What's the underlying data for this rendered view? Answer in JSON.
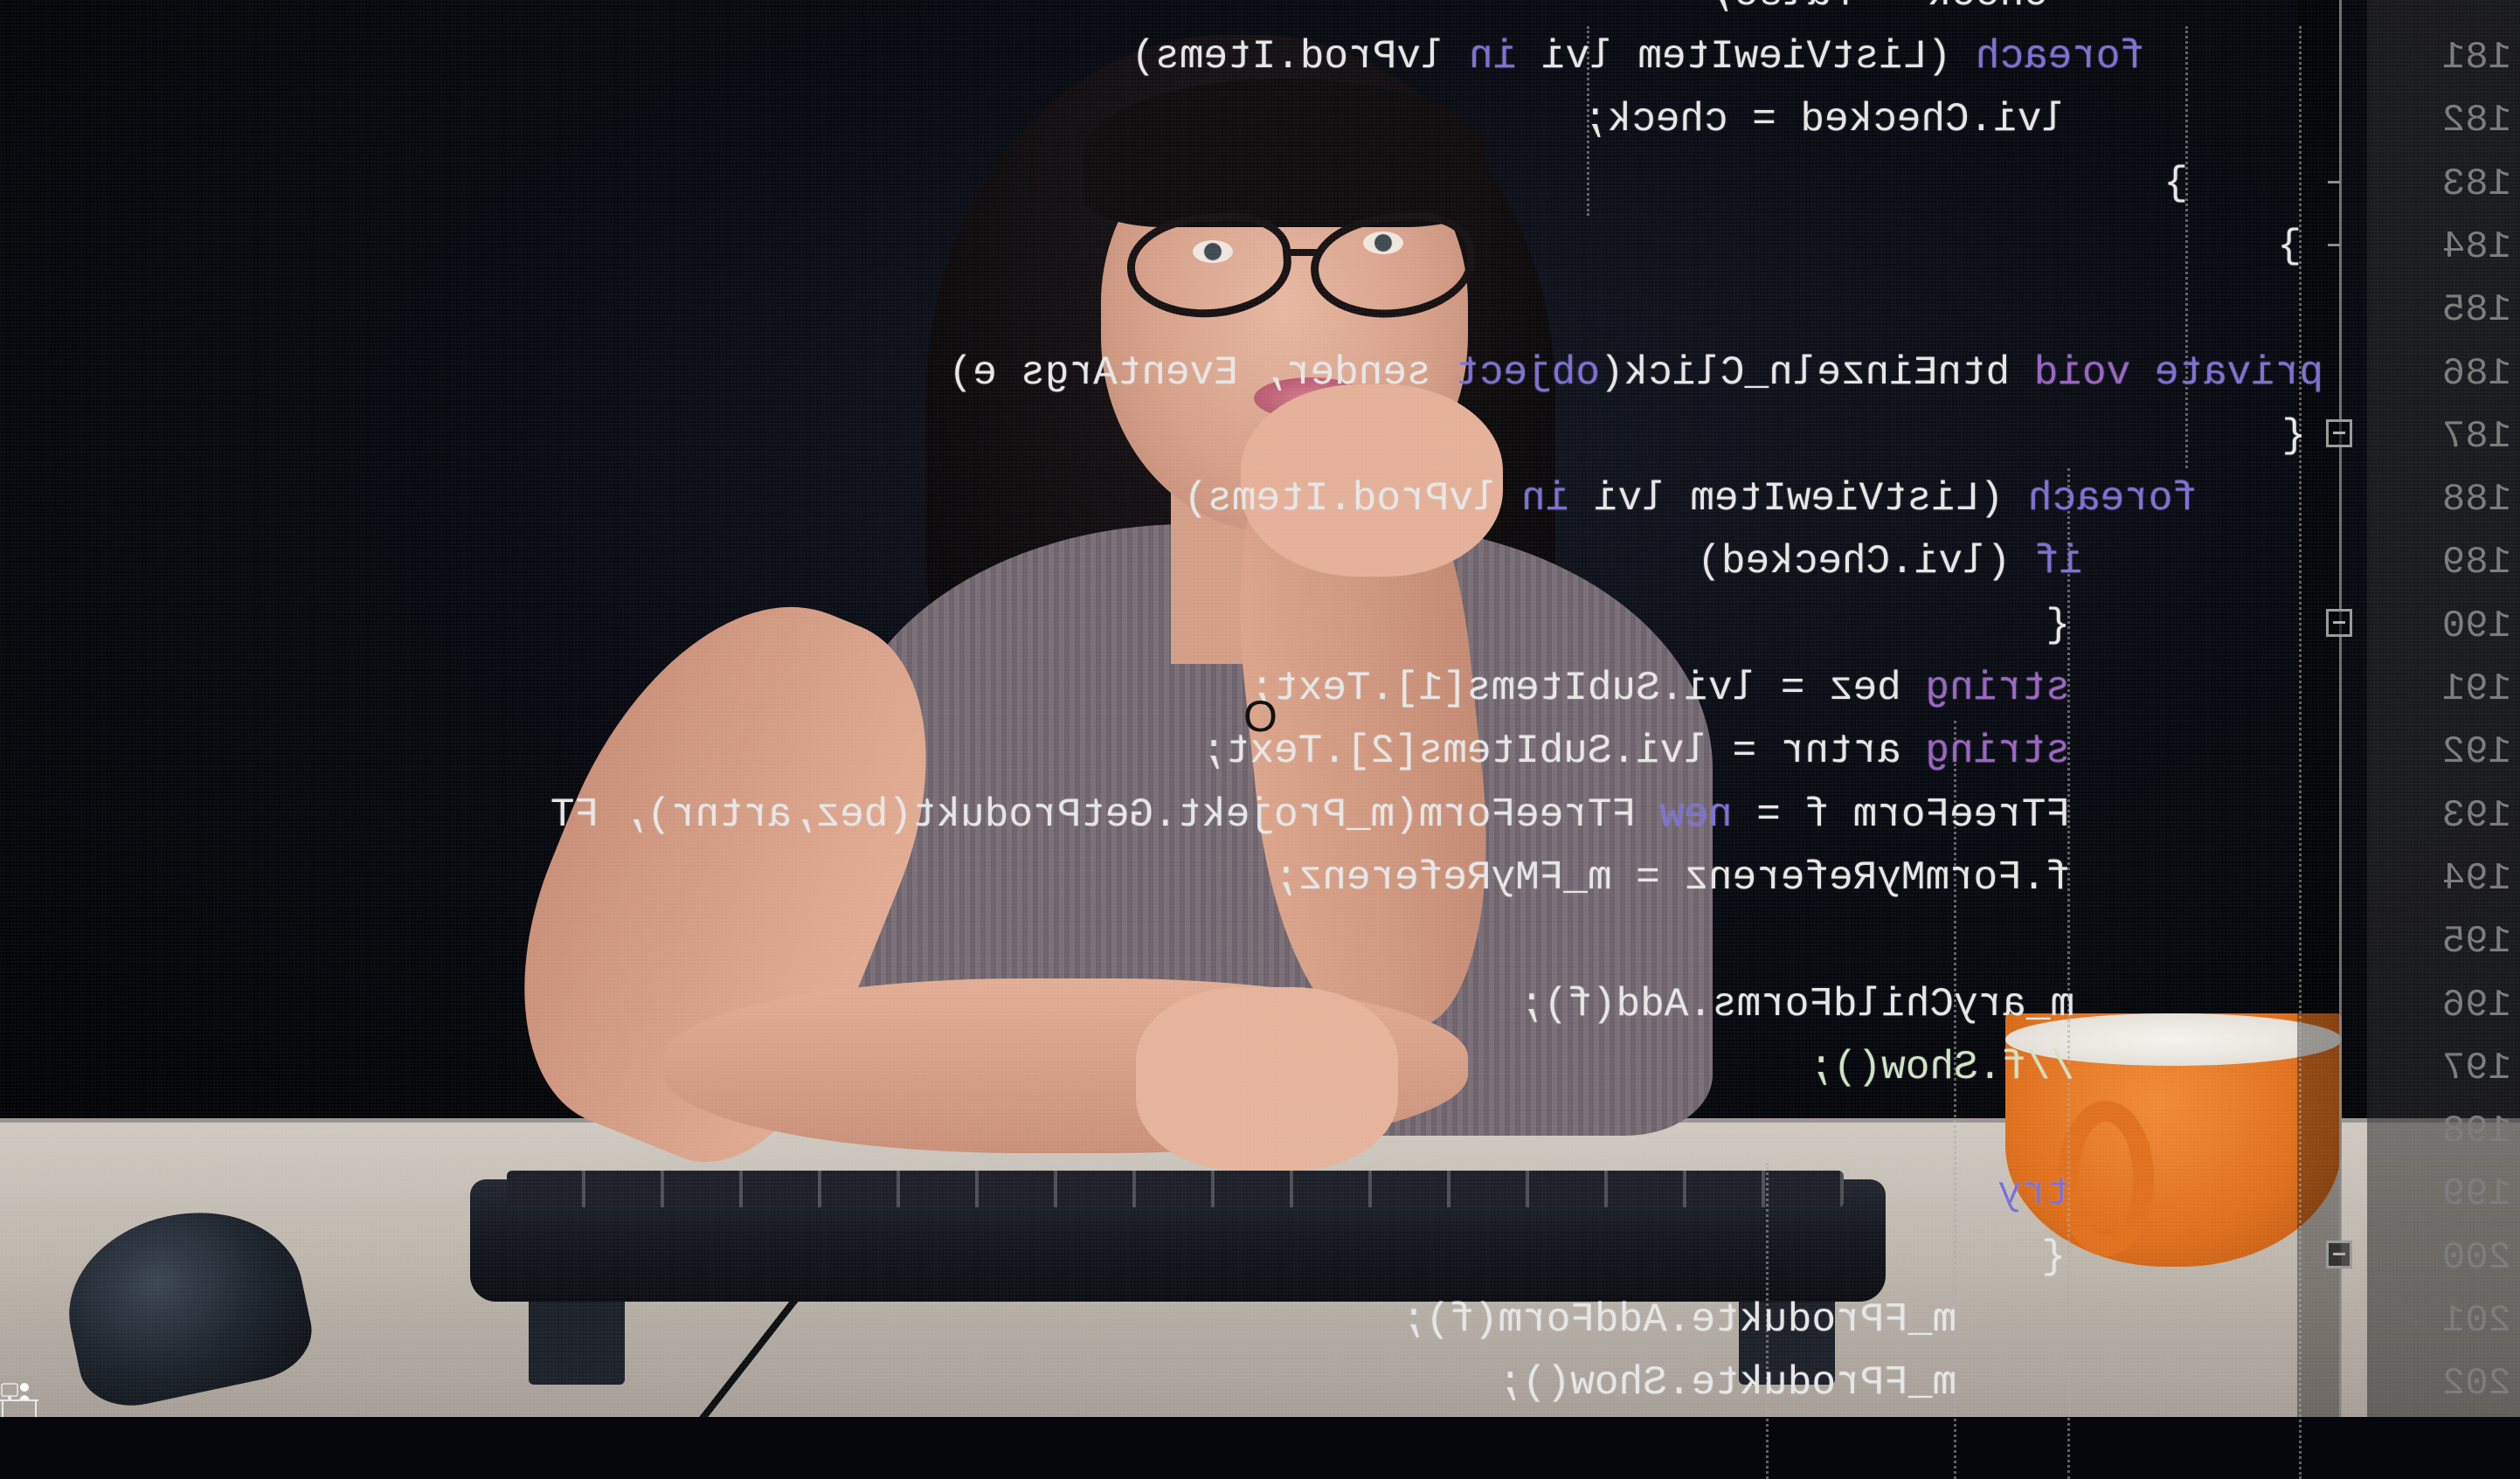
{
  "image": {
    "description": "Stock photo: woman with glasses resting chin on hand at a desk with keyboard, mouse and orange mug, overlaid with mirrored C# source code from a code editor",
    "overlay_mirrored": true
  },
  "editor": {
    "line_numbers": [
      "181",
      "182",
      "183",
      "184",
      "185",
      "186",
      "187",
      "188",
      "189",
      "190",
      "191",
      "192",
      "193",
      "194",
      "195",
      "196",
      "197",
      "198",
      "199",
      "200",
      "201",
      "202"
    ],
    "fold_markers": [
      {
        "line": "183",
        "type": "tick"
      },
      {
        "line": "184",
        "type": "tick"
      },
      {
        "line": "187",
        "type": "collapse"
      },
      {
        "line": "190",
        "type": "collapse"
      },
      {
        "line": "200",
        "type": "collapse"
      }
    ],
    "lines": [
      {
        "no": "181",
        "segments": [
          {
            "t": "foreach",
            "c": "kw"
          },
          {
            "t": " (ListViewItem lvi "
          },
          {
            "t": "in",
            "c": "kw"
          },
          {
            "t": " lvProd.Items)"
          }
        ]
      },
      {
        "no": "182",
        "segments": [
          {
            "t": "lvi.Checked = check;"
          }
        ]
      },
      {
        "no": "183",
        "segments": [
          {
            "t": "}"
          }
        ]
      },
      {
        "no": "184",
        "segments": [
          {
            "t": "}"
          }
        ]
      },
      {
        "no": "185",
        "segments": []
      },
      {
        "no": "186",
        "segments": [
          {
            "t": "private",
            "c": "kw"
          },
          {
            "t": " "
          },
          {
            "t": "void",
            "c": "kw-purple"
          },
          {
            "t": " btnEinzeln_Click("
          },
          {
            "t": "object",
            "c": "kw"
          },
          {
            "t": " sender, EventArgs e)"
          }
        ]
      },
      {
        "no": "187",
        "segments": [
          {
            "t": "{"
          }
        ]
      },
      {
        "no": "188",
        "segments": [
          {
            "t": "foreach",
            "c": "kw"
          },
          {
            "t": " (ListViewItem lvi "
          },
          {
            "t": "in",
            "c": "kw"
          },
          {
            "t": " lvProd.Items)"
          }
        ]
      },
      {
        "no": "189",
        "segments": [
          {
            "t": "if",
            "c": "kw"
          },
          {
            "t": " (lvi.Checked)"
          }
        ]
      },
      {
        "no": "190",
        "segments": [
          {
            "t": "{"
          }
        ]
      },
      {
        "no": "191",
        "segments": [
          {
            "t": "string",
            "c": "kw-purple"
          },
          {
            "t": " bez = lvi.SubItems[1].Text;"
          }
        ]
      },
      {
        "no": "192",
        "segments": [
          {
            "t": "string",
            "c": "kw-purple"
          },
          {
            "t": " artnr = lvi.SubItems[2].Text;"
          }
        ]
      },
      {
        "no": "193",
        "segments": [
          {
            "t": "FTreeForm f = "
          },
          {
            "t": "new",
            "c": "kw"
          },
          {
            "t": " FTreeForm(m_Projekt.GetProdukt(bez,artnr), FT"
          }
        ]
      },
      {
        "no": "194",
        "segments": [
          {
            "t": "f.FormMyReferenz = m_FMyReferenz;"
          }
        ]
      },
      {
        "no": "195",
        "segments": []
      },
      {
        "no": "196",
        "segments": [
          {
            "t": "m_aryChildForms.Add(f);"
          }
        ]
      },
      {
        "no": "197",
        "segments": [
          {
            "t": "//f.Show();",
            "c": "cm"
          }
        ]
      },
      {
        "no": "198",
        "segments": []
      },
      {
        "no": "199",
        "segments": [
          {
            "t": "try",
            "c": "kw"
          }
        ]
      },
      {
        "no": "200",
        "segments": [
          {
            "t": "{"
          }
        ]
      },
      {
        "no": "201",
        "segments": [
          {
            "t": "m_FProdukte.AddForm(f);"
          }
        ]
      },
      {
        "no": "202",
        "segments": [
          {
            "t": "m_FProdukte.Show();"
          }
        ]
      }
    ],
    "partial_top_line": {
      "no": "180",
      "text": "check = false;"
    }
  },
  "cursor": {
    "glyph": "O"
  },
  "corner_icon": {
    "name": "person-at-desk-icon"
  },
  "colors": {
    "keyword": "#7b6fd6",
    "type_keyword": "#9a63c4",
    "comment": "#cfe3c4",
    "code_text": "#e6e6e6",
    "line_number": "#7a7a7a",
    "mug": "#e0701c",
    "background": "#05070d"
  }
}
